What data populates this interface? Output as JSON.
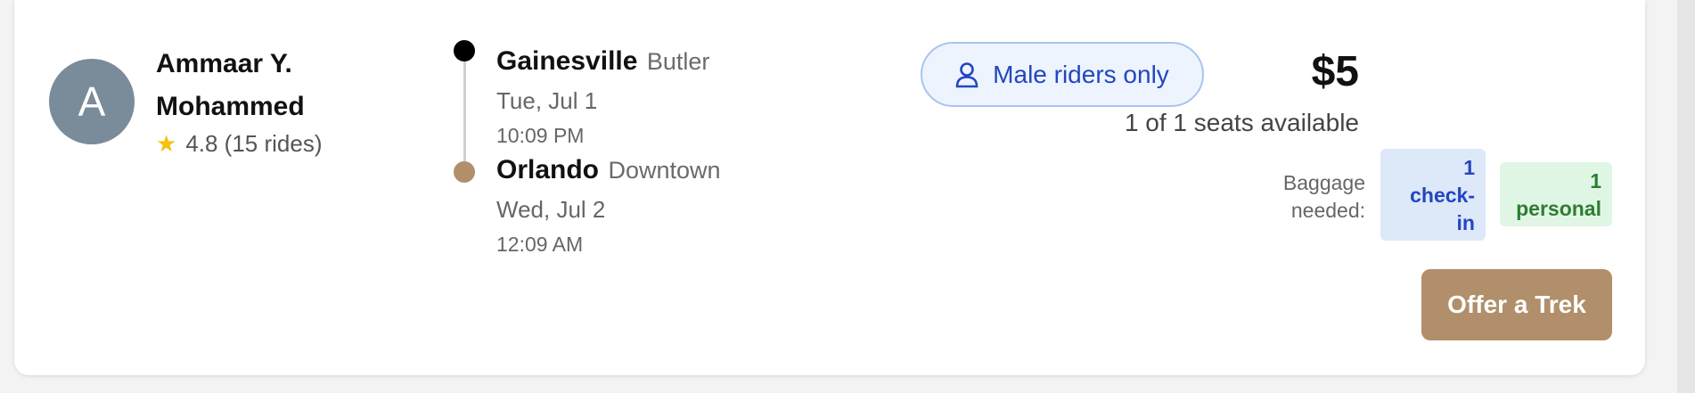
{
  "driver": {
    "avatar_initial": "A",
    "name_line1": "Ammaar Y.",
    "name_line2": "Mohammed",
    "rating": "4.8 (15 rides)"
  },
  "route": {
    "origin": {
      "city": "Gainesville",
      "area": "Butler",
      "date": "Tue, Jul 1",
      "time": "10:09 PM"
    },
    "destination": {
      "city": "Orlando",
      "area": "Downtown",
      "date": "Wed, Jul 2",
      "time": "12:09 AM"
    }
  },
  "preference": {
    "label": "Male riders only",
    "icon": "person-icon"
  },
  "pricing": {
    "price": "$5",
    "seats": "1 of 1 seats available"
  },
  "baggage": {
    "label_line1": "Baggage",
    "label_line2": "needed:",
    "checkin_line1": "1",
    "checkin_line2": "check-",
    "checkin_line3": "in",
    "personal_line1": "1",
    "personal_line2": "personal"
  },
  "actions": {
    "offer_label": "Offer a Trek"
  },
  "colors": {
    "avatar_bg": "#7a8b99",
    "accent_brown": "#b08f6a",
    "pill_blue": "#2346c0",
    "checkin_bg": "#dde8f9",
    "personal_bg": "#e0f6e4",
    "personal_text": "#2e7d32",
    "star": "#f4c20d"
  }
}
